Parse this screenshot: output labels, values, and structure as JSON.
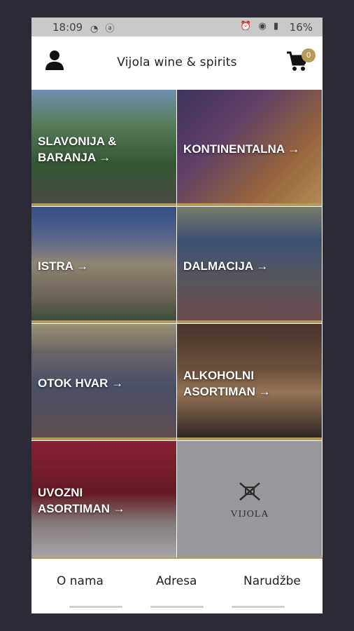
{
  "status_bar": {
    "time": "18:09",
    "battery": "16%"
  },
  "header": {
    "title": "Vijola wine & spirits",
    "cart_count": "0"
  },
  "regions": [
    {
      "line1": "SLAVONIJA &",
      "line2": "BARANJA →"
    },
    {
      "line1": "KONTINENTALNA →",
      "line2": ""
    },
    {
      "line1": "ISTRA →",
      "line2": ""
    },
    {
      "line1": "DALMACIJA →",
      "line2": ""
    },
    {
      "line1": "OTOK HVAR →",
      "line2": ""
    },
    {
      "line1": "ALKOHOLNI",
      "line2": "ASORTIMAN →"
    },
    {
      "line1": "UVOZNI",
      "line2": "ASORTIMAN →"
    }
  ],
  "logo": {
    "wordmark": "VIJOLA"
  },
  "bottom_nav": {
    "about": "O nama",
    "address": "Adresa",
    "orders": "Narudžbe"
  },
  "colors": {
    "accent": "#b69a5c",
    "background": "#2c2a36"
  }
}
